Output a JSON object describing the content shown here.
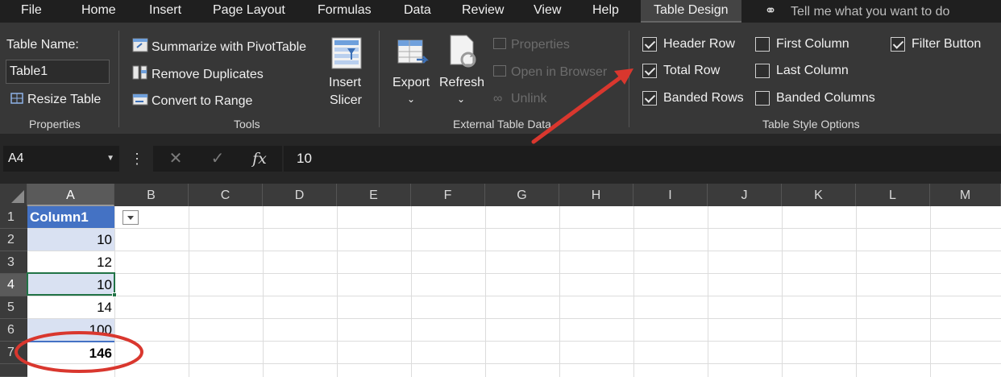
{
  "menu": {
    "tabs": [
      "File",
      "Home",
      "Insert",
      "Page Layout",
      "Formulas",
      "Data",
      "Review",
      "View",
      "Help",
      "Table Design"
    ],
    "active_tab": "Table Design",
    "tell_me": "Tell me what you want to do"
  },
  "ribbon": {
    "properties": {
      "table_name_label": "Table Name:",
      "table_name_value": "Table1",
      "resize": "Resize Table",
      "group": "Properties"
    },
    "tools": {
      "summarize": "Summarize with PivotTable",
      "remove_duplicates": "Remove Duplicates",
      "convert": "Convert to Range",
      "insert_slicer_1": "Insert",
      "insert_slicer_2": "Slicer",
      "group": "Tools"
    },
    "external": {
      "export": "Export",
      "refresh": "Refresh",
      "properties": "Properties",
      "open_browser": "Open in Browser",
      "unlink": "Unlink",
      "group": "External Table Data"
    },
    "style_options": {
      "header_row": "Header Row",
      "total_row": "Total Row",
      "banded_rows": "Banded Rows",
      "first_column": "First Column",
      "last_column": "Last Column",
      "banded_columns": "Banded Columns",
      "filter_button": "Filter Button",
      "group": "Table Style Options"
    }
  },
  "formula_bar": {
    "name_box": "A4",
    "value": "10",
    "fx": "fx"
  },
  "grid": {
    "columns": [
      "A",
      "B",
      "C",
      "D",
      "E",
      "F",
      "G",
      "H",
      "I",
      "J",
      "K",
      "L",
      "M"
    ],
    "rows": [
      "1",
      "2",
      "3",
      "4",
      "5",
      "6",
      "7"
    ],
    "selected_cell": "A4",
    "cells": {
      "a1": "Column1",
      "a2": "10",
      "a3": "12",
      "a4": "10",
      "a5": "14",
      "a6": "100",
      "a7": "146"
    }
  },
  "colors": {
    "table_header": "#4472c4",
    "band": "#d9e1f2",
    "annotation": "#d9372e"
  }
}
